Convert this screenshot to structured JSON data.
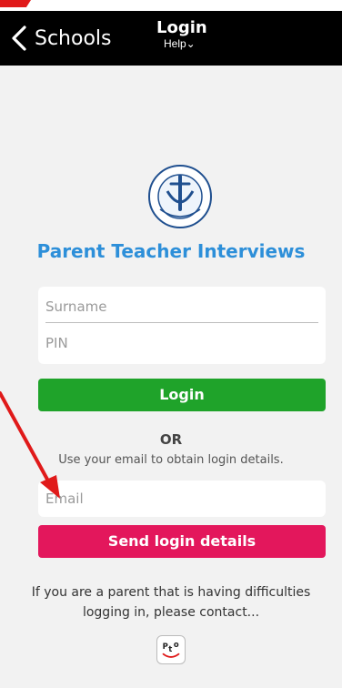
{
  "nav": {
    "back_label": "Schools",
    "title": "Login",
    "help_label": "Help⌄"
  },
  "app": {
    "title": "Parent Teacher Interviews"
  },
  "login_form": {
    "surname_placeholder": "Surname",
    "pin_placeholder": "PIN",
    "login_button": "Login"
  },
  "alt_login": {
    "or_label": "OR",
    "hint": "Use your email to obtain login details.",
    "email_placeholder": "Email",
    "send_button": "Send login details"
  },
  "footer": {
    "help_text": "If you are a parent that is having difficulties logging in, please contact..."
  },
  "icons": {
    "back": "chevron-left-icon",
    "school_logo": "school-crest-icon",
    "pto_logo": "pto-logo-icon",
    "annotation": "red-arrow-icon"
  },
  "colors": {
    "nav_bg": "#000000",
    "title_blue": "#2d8fd9",
    "login_green": "#1fa32a",
    "send_pink": "#e3175c",
    "annotation_red": "#e01a1a"
  }
}
